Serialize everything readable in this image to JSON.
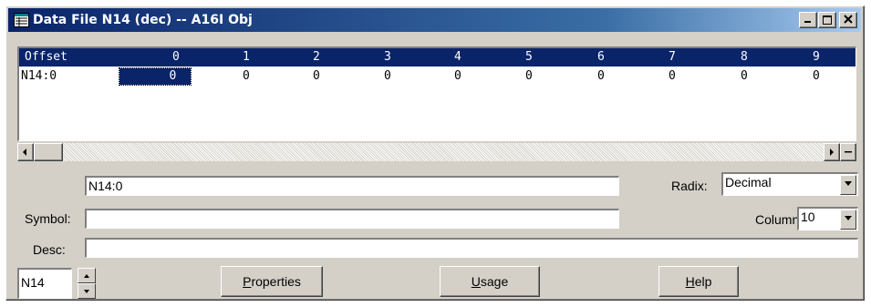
{
  "window": {
    "title": "Data File N14 (dec) -- A16I Obj",
    "minimize_label": "_",
    "close_label": "×"
  },
  "grid": {
    "header_label": "Offset",
    "columns": [
      "0",
      "1",
      "2",
      "3",
      "4",
      "5",
      "6",
      "7",
      "8",
      "9"
    ],
    "rows": [
      {
        "address": "N14:0",
        "values": [
          "0",
          "0",
          "0",
          "0",
          "0",
          "0",
          "0",
          "0",
          "0",
          "0"
        ]
      }
    ],
    "selected_cell": {
      "row": 0,
      "column": "0"
    }
  },
  "address_field": {
    "value": "N14:0"
  },
  "symbol": {
    "label": "Symbol:",
    "value": ""
  },
  "desc": {
    "label": "Desc:",
    "value": ""
  },
  "radix": {
    "label": "Radix:",
    "value": "Decimal"
  },
  "columns_select": {
    "label": "Columns:",
    "value": "10"
  },
  "file_selector": {
    "value": "N14"
  },
  "buttons": {
    "properties": {
      "underline": "P",
      "rest": "roperties"
    },
    "usage": {
      "underline": "U",
      "rest": "sage"
    },
    "help": {
      "underline": "H",
      "rest": "elp"
    }
  },
  "colors": {
    "title_bar": "#0a246a",
    "grid_header": "#0a246a",
    "face": "#d4d0c8"
  },
  "icons": [
    "data-file-icon",
    "minimize-icon",
    "restore-icon",
    "close-icon",
    "scroll-left-icon",
    "scroll-right-icon",
    "split-icon",
    "dropdown-arrow-icon",
    "spin-up-icon",
    "spin-down-icon"
  ]
}
